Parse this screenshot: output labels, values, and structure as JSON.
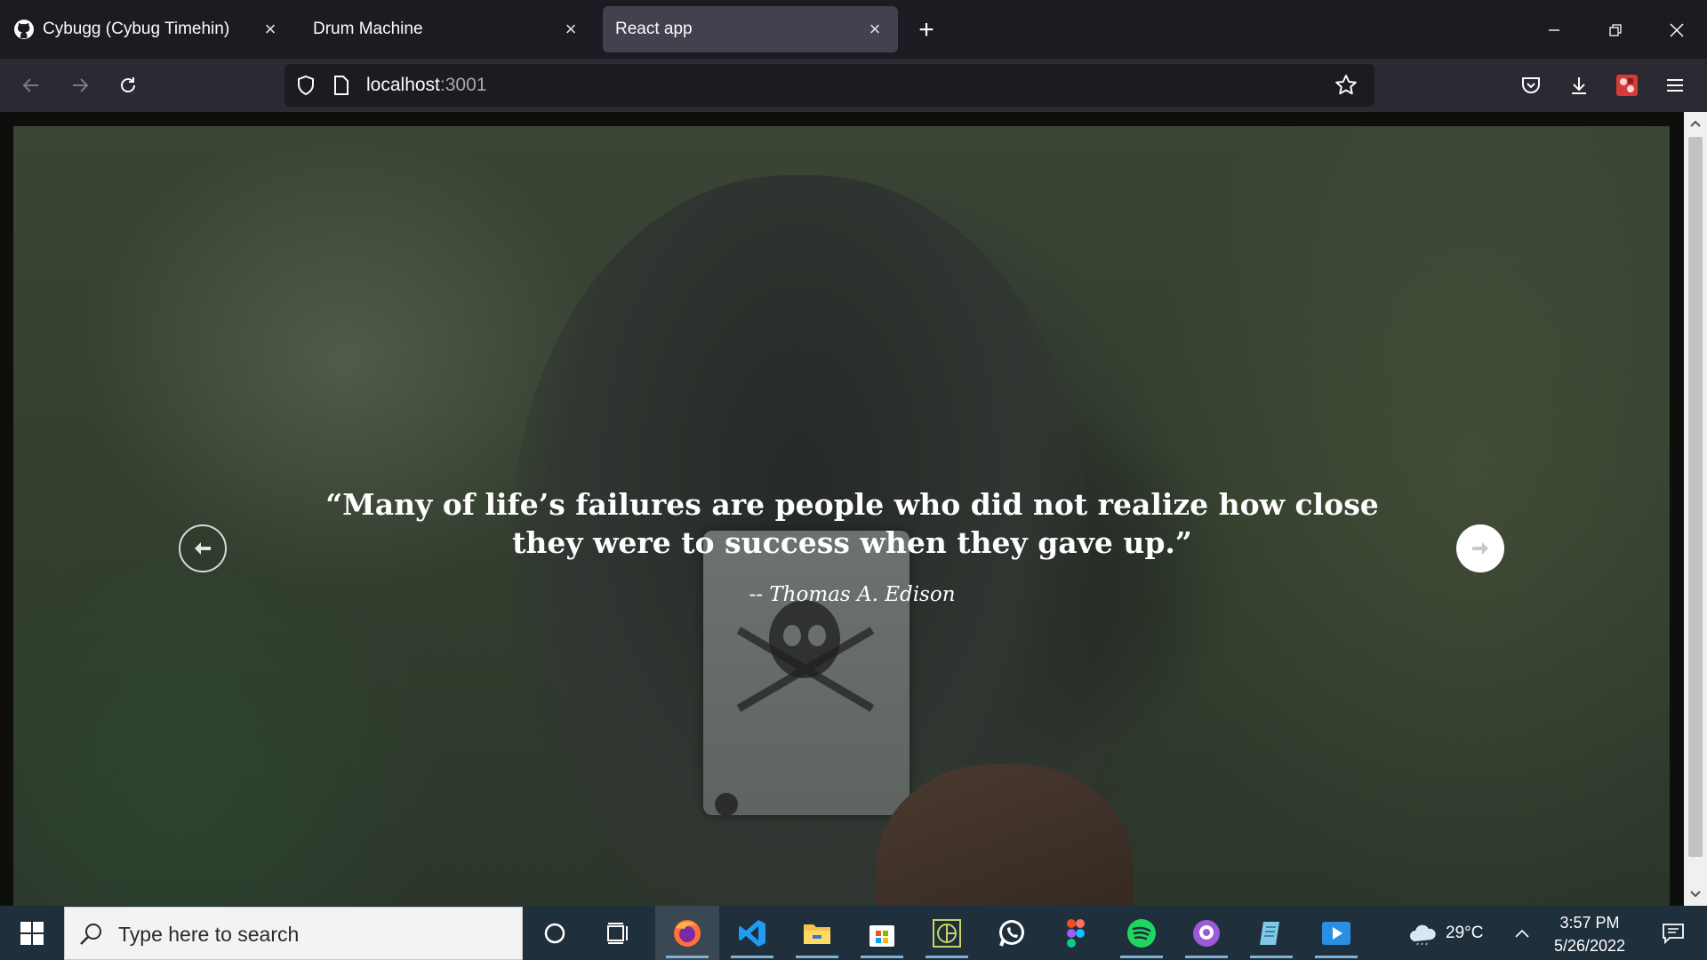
{
  "browser": {
    "tabs": [
      {
        "label": "Cybugg (Cybug Timehin)",
        "favicon": "github-icon",
        "active": false
      },
      {
        "label": "Drum Machine",
        "favicon": "none",
        "active": false
      },
      {
        "label": "React app",
        "favicon": "none",
        "active": true
      }
    ],
    "new_tab_symbol": "+",
    "url_host": "localhost",
    "url_port": ":3001"
  },
  "page": {
    "quote": "“Many of life’s failures are people who did not realize how close they were to success when they gave up.”",
    "author": "-- Thomas A. Edison"
  },
  "taskbar": {
    "search_placeholder": "Type here to search",
    "apps": [
      "cortana-icon",
      "task-view-icon",
      "firefox-icon",
      "vscode-icon",
      "file-explorer-icon",
      "microsoft-store-icon",
      "ide-icon",
      "whatsapp-icon",
      "figma-icon",
      "spotify-icon",
      "github-desktop-icon",
      "notepad-icon",
      "media-player-icon"
    ],
    "weather_temp": "29°C",
    "time": "3:57 PM",
    "date": "5/26/2022"
  },
  "colors": {
    "browser_bg": "#1c1b22",
    "toolbar_bg": "#2b2a33",
    "taskbar_bg": "#1f2f3c"
  }
}
